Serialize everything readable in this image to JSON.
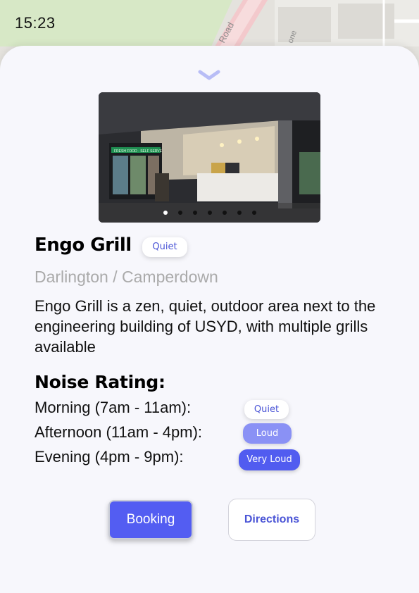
{
  "status_bar": {
    "time": "15:23"
  },
  "map": {
    "road_label_1": "Road",
    "road_label_2": "one"
  },
  "place": {
    "name": "Engo Grill",
    "current_noise_badge": "Quiet",
    "location": "Darlington / Camperdown",
    "description": "Engo Grill is a zen, quiet, outdoor area next to the engineering building of USYD, with multiple grills available",
    "photo_sign": "FRESH FOOD · SELF SERVE",
    "carousel": {
      "total": 7,
      "active_index": 0
    }
  },
  "noise": {
    "heading": "Noise Rating:",
    "periods": [
      {
        "label": "Morning (7am - 11am):",
        "rating": "Quiet"
      },
      {
        "label": "Afternoon (11am - 4pm):",
        "rating": "Loud"
      },
      {
        "label": "Evening (4pm - 9pm):",
        "rating": "Very Loud"
      }
    ]
  },
  "actions": {
    "booking": "Booking",
    "directions": "Directions"
  },
  "colors": {
    "accent": "#535df2",
    "quiet_text": "#4a54d6",
    "loud": "#8a91f5",
    "very_loud": "#515cf0",
    "sheet": "#f7f7fc"
  },
  "icons": {
    "collapse": "chevron-down-icon"
  }
}
